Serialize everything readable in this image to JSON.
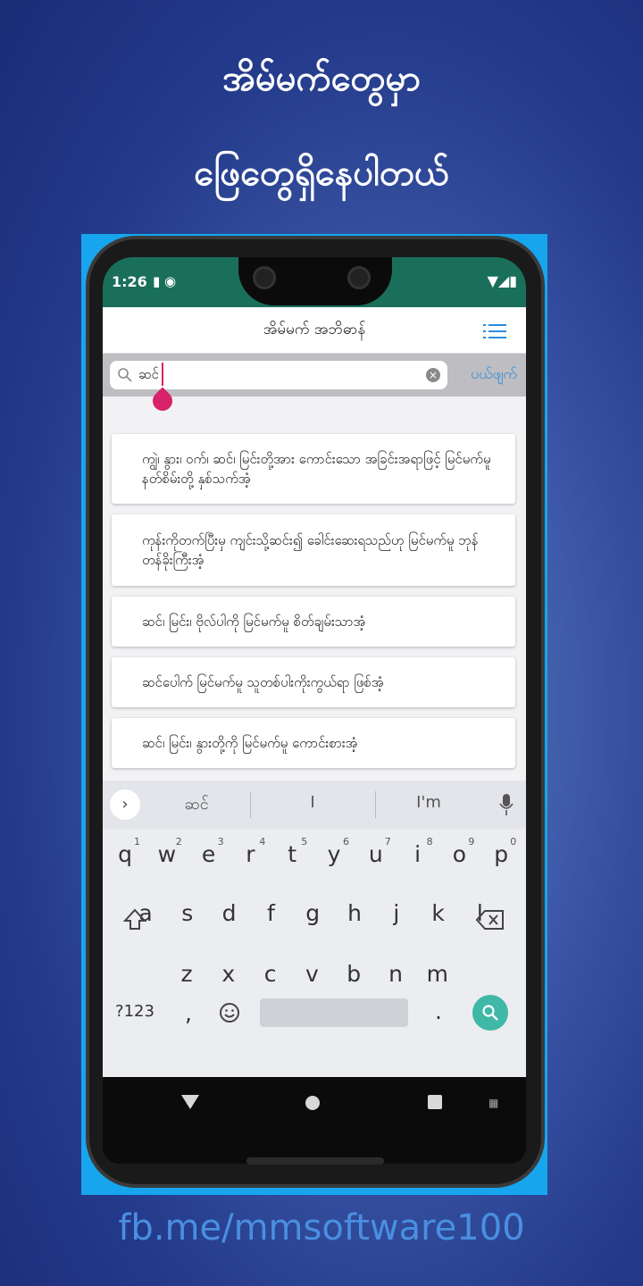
{
  "banner": {
    "line1": "အိမ်မက်တွေမှာ",
    "line2": "ဖြေတွေရှိနေပါတယ်",
    "footer": "fb.me/mmsoftware100"
  },
  "status_bar": {
    "time": "1:26"
  },
  "app": {
    "title": "အိမ်မက် အဘိဓာန်",
    "menu_icon": "hamburger-list-icon",
    "search": {
      "value": "ဆင်",
      "cancel_label": "ပယ်ဖျက်"
    },
    "results": [
      "ကျွဲ၊ နွား၊ ဝက်၊ ဆင်၊ မြင်းတို့အား ကောင်းသော အခြင်းအရာဖြင့် မြင်မက်မူ နတ်စိမ်းတို့ နှစ်သက်အံ့",
      "ကုန်းကိုတက်ပြီးမှ ကျင်းသို့ဆင်း၍ ခေါင်းဆေးရသည်ဟု မြင်မက်မူ ဘုန်တန်ခိုးကြီးအံ့",
      "ဆင်၊ မြင်း၊ ဗိုလ်ပါကို မြင်မက်မူ စိတ်ချမ်းသာအံ့",
      "ဆင်ပေါက် မြင်မက်မူ သူတစ်ပါးကိုးကွယ်ရာ ဖြစ်အံ့",
      "ဆင်၊ မြင်း၊ နွားတို့ကို မြင်မက်မူ ကောင်းစားအံ့"
    ]
  },
  "keyboard": {
    "suggestions": [
      "ဆင်",
      "I",
      "I'm"
    ],
    "row1": [
      "q",
      "w",
      "e",
      "r",
      "t",
      "y",
      "u",
      "i",
      "o",
      "p"
    ],
    "row1_nums": [
      "1",
      "2",
      "3",
      "4",
      "5",
      "6",
      "7",
      "8",
      "9",
      "0"
    ],
    "row2": [
      "a",
      "s",
      "d",
      "f",
      "g",
      "h",
      "j",
      "k",
      "l"
    ],
    "row3": [
      "z",
      "x",
      "c",
      "v",
      "b",
      "n",
      "m"
    ],
    "symbols_label": "?123",
    "comma": ",",
    "period": "."
  }
}
